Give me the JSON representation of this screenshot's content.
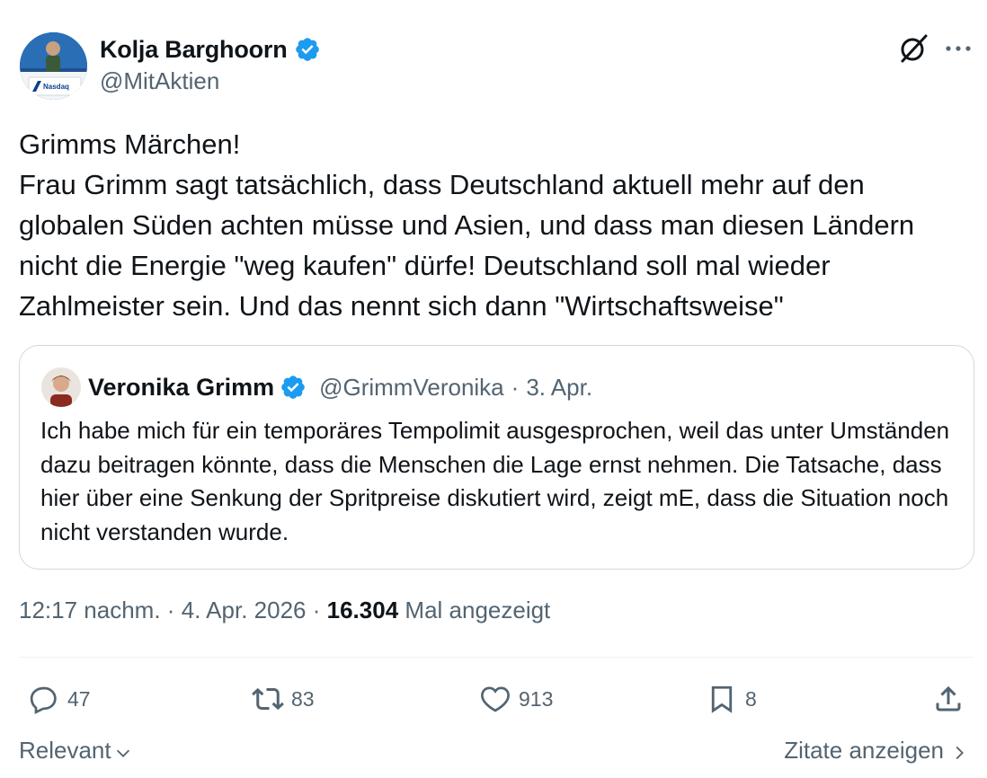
{
  "author": {
    "name": "Kolja Barghoorn",
    "handle": "@MitAktien",
    "avatar_text": "Nasdaq"
  },
  "tweet": {
    "text": "Grimms Märchen!\nFrau Grimm sagt tatsächlich, dass Deutschland aktuell mehr auf den globalen Süden achten müsse und Asien, und dass man diesen Ländern nicht die Energie \"weg kaufen\" dürfe! Deutschland soll mal wieder Zahlmeister sein. Und das nennt sich dann \"Wirtschaftsweise\""
  },
  "quote": {
    "name": "Veronika Grimm",
    "handle": "@GrimmVeronika",
    "separator": "·",
    "date": "3. Apr.",
    "text": "Ich habe mich für ein temporäres Tempolimit ausgesprochen, weil das unter Umständen dazu beitragen könnte, dass die Menschen die Lage ernst nehmen. Die Tatsache, dass hier über eine Senkung der Spritpreise diskutiert wird, zeigt mE, dass die Situation noch nicht verstanden wurde."
  },
  "meta": {
    "time": "12:17 nachm.",
    "sep1": "·",
    "date": "4. Apr. 2026",
    "sep2": "·",
    "views": "16.304",
    "views_label": "Mal angezeigt"
  },
  "actions": {
    "replies": "47",
    "reposts": "83",
    "likes": "913",
    "bookmarks": "8"
  },
  "footer": {
    "sort_label": "Relevant",
    "quotes_label": "Zitate anzeigen"
  },
  "colors": {
    "text": "#0f1419",
    "secondary": "#536471",
    "border": "#cfd9de",
    "verified": "#1d9bf0",
    "divider": "#eff3f4"
  },
  "icons": {
    "verified": "verified-badge-icon",
    "grok": "grok-icon",
    "more": "more-icon",
    "reply": "reply-icon",
    "repost": "repost-icon",
    "like": "like-icon",
    "bookmark": "bookmark-icon",
    "share": "share-icon",
    "chevron_down": "chevron-down-icon",
    "chevron_right": "chevron-right-icon"
  }
}
